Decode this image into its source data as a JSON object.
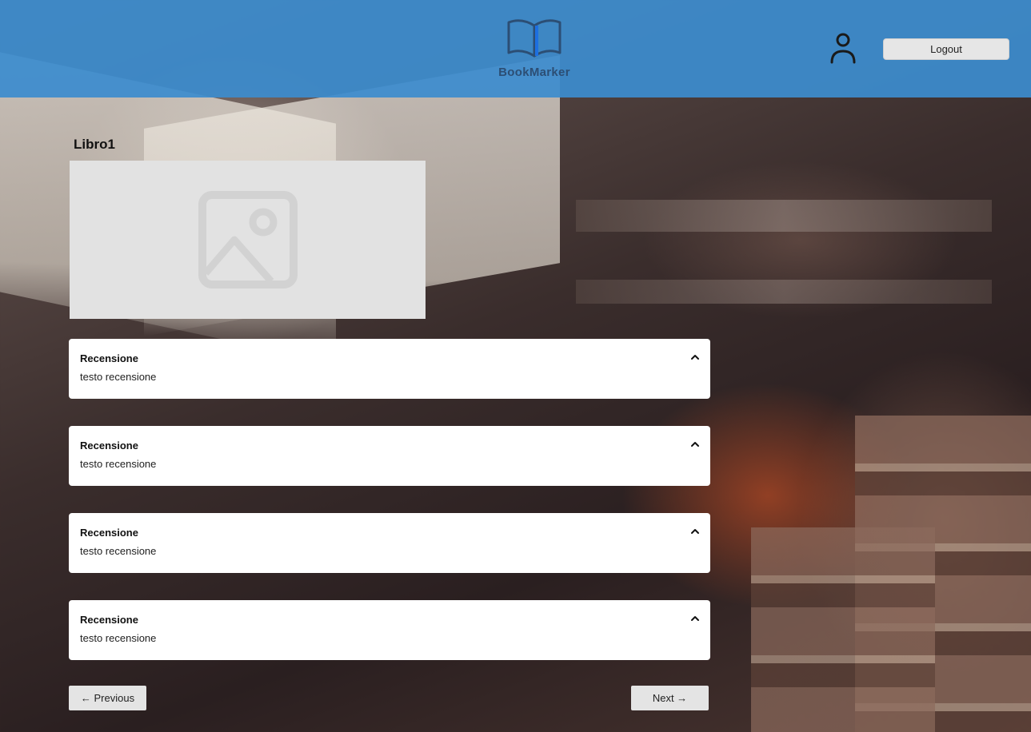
{
  "header": {
    "brand": "BookMarker",
    "logout_label": "Logout",
    "color": "#3c8ccd"
  },
  "book": {
    "title": "Libro1",
    "cover_icon": "image-placeholder-icon"
  },
  "reviews": [
    {
      "title": "Recensione",
      "text": "testo recensione"
    },
    {
      "title": "Recensione",
      "text": "testo recensione"
    },
    {
      "title": "Recensione",
      "text": "testo recensione"
    },
    {
      "title": "Recensione",
      "text": "testo recensione"
    }
  ],
  "pagination": {
    "previous_label": "← Previous",
    "next_label": "Next →"
  },
  "icons": {
    "logo": "open-book-icon",
    "user": "user-icon",
    "review_toggle": "chevron-up-icon"
  }
}
